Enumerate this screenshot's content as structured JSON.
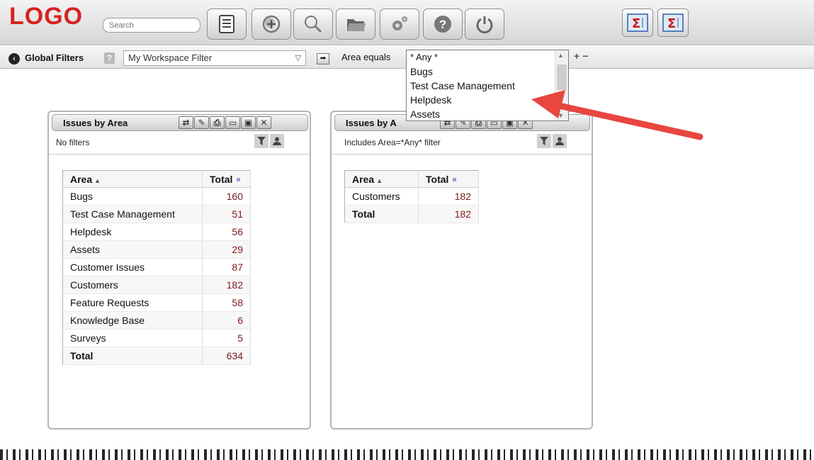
{
  "app": {
    "logo": "LOGO"
  },
  "toolbar": {
    "search_placeholder": "Search",
    "buttons": [
      "list-icon",
      "add-icon",
      "search-icon",
      "folder-icon",
      "gears-icon",
      "help-icon",
      "power-icon"
    ],
    "sum_buttons": [
      "sigma-icon",
      "sigma-icon"
    ]
  },
  "filters": {
    "label": "Global Filters",
    "help": "?",
    "workspace_filter": "My Workspace Filter",
    "area_label": "Area equals",
    "area_options": [
      "* Any *",
      "Bugs",
      "Test Case Management",
      "Helpdesk",
      "Assets"
    ]
  },
  "panel1": {
    "title": "Issues by Area",
    "subtitle": "No filters",
    "columns": [
      "Area",
      "Total"
    ],
    "rows": [
      [
        "Bugs",
        "160"
      ],
      [
        "Test Case Management",
        "51"
      ],
      [
        "Helpdesk",
        "56"
      ],
      [
        "Assets",
        "29"
      ],
      [
        "Customer Issues",
        "87"
      ],
      [
        "Customers",
        "182"
      ],
      [
        "Feature Requests",
        "58"
      ],
      [
        "Knowledge Base",
        "6"
      ],
      [
        "Surveys",
        "5"
      ]
    ],
    "total_label": "Total",
    "total_value": "634"
  },
  "panel2": {
    "title": "Issues by A",
    "subtitle": "Includes Area=*Any* filter",
    "columns": [
      "Area",
      "Total"
    ],
    "rows": [
      [
        "Customers",
        "182"
      ]
    ],
    "total_label": "Total",
    "total_value": "182"
  },
  "colors": {
    "logo": "#d8221d",
    "value_text": "#7b1b1b",
    "annotation_arrow": "#e8463f"
  }
}
